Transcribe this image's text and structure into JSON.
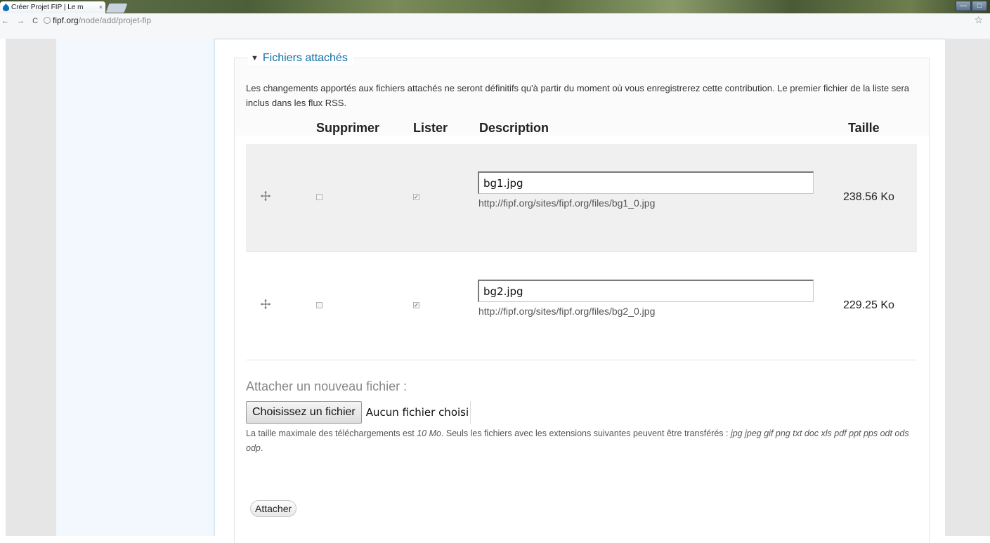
{
  "browser": {
    "tab_title": "Créer Projet FIP | Le m",
    "tab_close": "×",
    "url_host": "fipf.org",
    "url_path": "/node/add/projet-fip",
    "nav_glyphs": "← → C"
  },
  "section": {
    "legend": "Fichiers attachés",
    "description": "Les changements apportés aux fichiers attachés ne seront définitifs qu'à partir du moment où vous enregistrerez cette contribution. Le premier fichier de la liste sera inclus dans les flux RSS."
  },
  "table": {
    "headers": {
      "delete": "Supprimer",
      "list": "Lister",
      "description": "Description",
      "size": "Taille"
    },
    "rows": [
      {
        "description": "bg1.jpg",
        "url": "http://fipf.org/sites/fipf.org/files/bg1_0.jpg",
        "size": "238.56 Ko",
        "delete": false,
        "list": true
      },
      {
        "description": "bg2.jpg",
        "url": "http://fipf.org/sites/fipf.org/files/bg2_0.jpg",
        "size": "229.25 Ko",
        "delete": false,
        "list": true
      }
    ]
  },
  "new_file": {
    "label": "Attacher un nouveau fichier :",
    "choose_button": "Choisissez un fichier",
    "no_file": "Aucun fichier choisi",
    "help_prefix": "La taille maximale des téléchargements est ",
    "help_max": "10 Mo",
    "help_middle": ". Seuls les fichiers avec les extensions suivantes peuvent être transférés : ",
    "help_extensions": "jpg jpeg gif png txt doc xls pdf ppt pps odt ods odp",
    "help_suffix": ".",
    "attach_button": "Attacher"
  },
  "colors": {
    "legend": "#0d6ea8",
    "odd_row": "#f0f0f0",
    "sidebar": "#f2f8fd"
  }
}
